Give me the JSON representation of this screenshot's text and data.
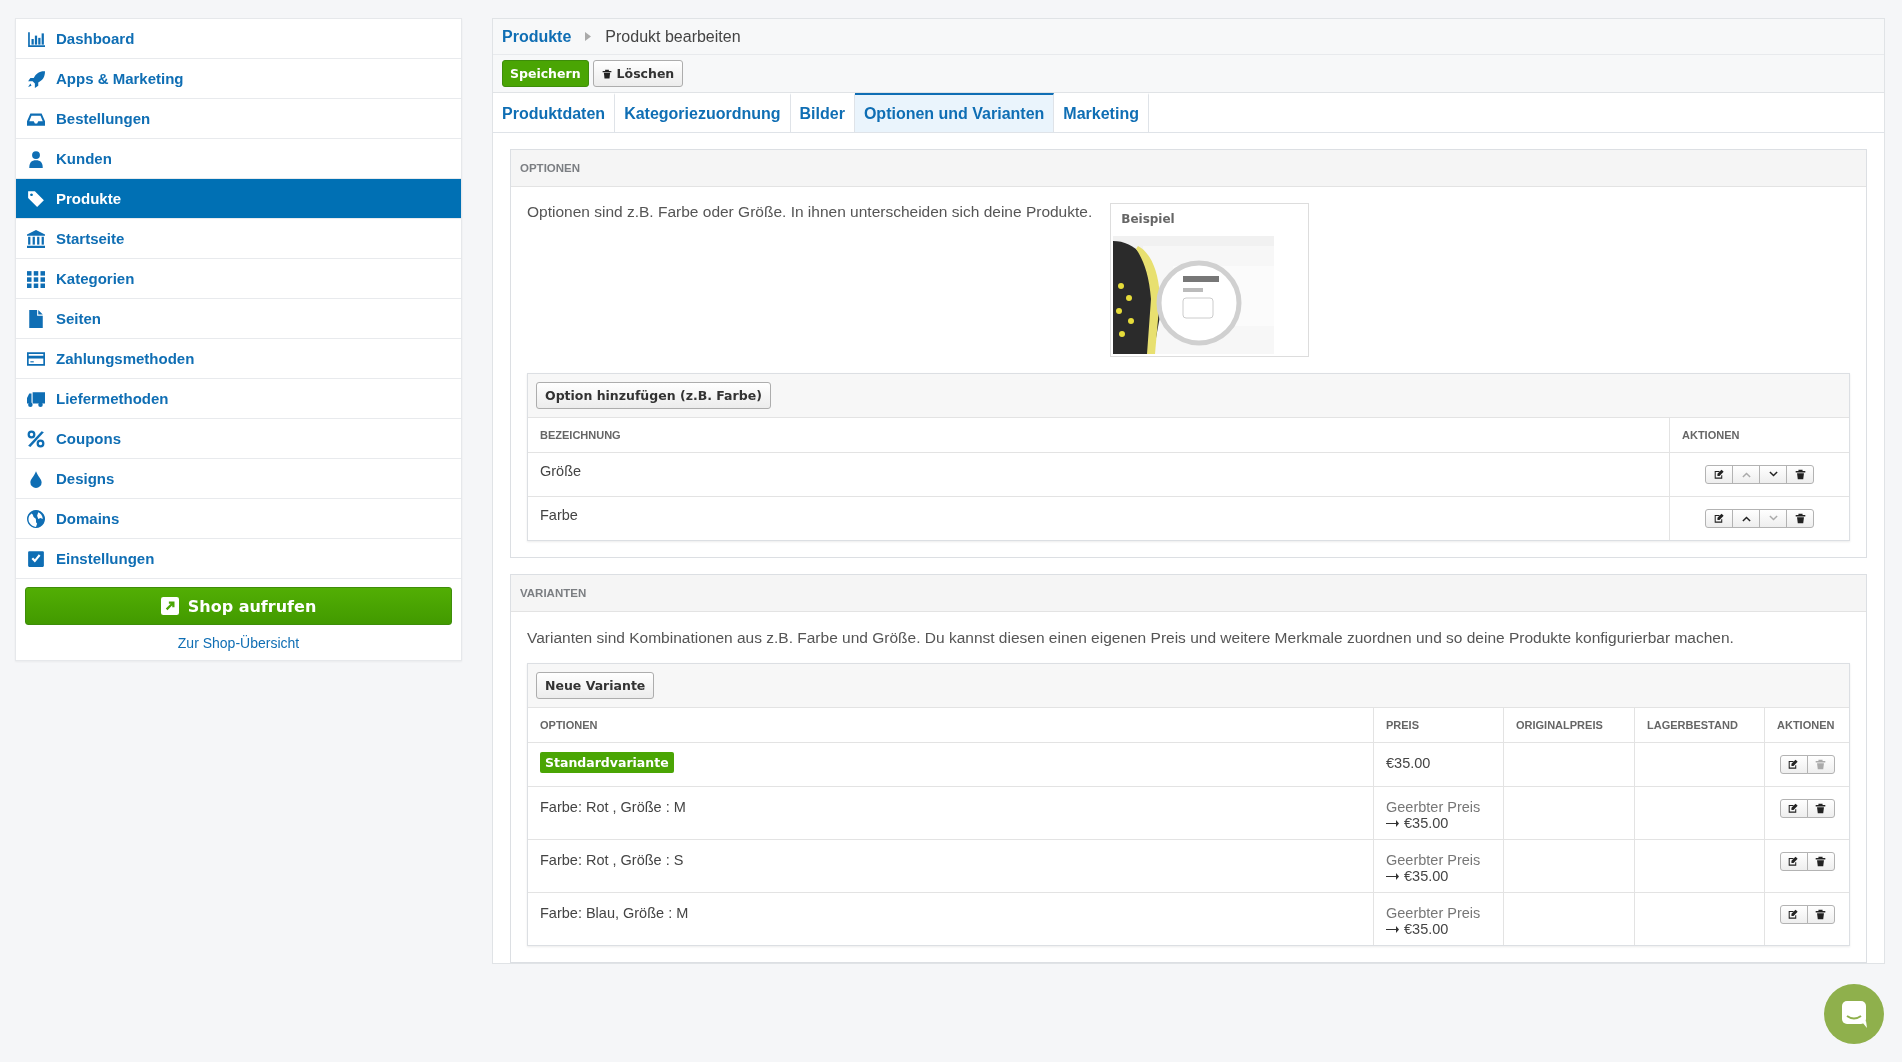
{
  "sidebar": {
    "items": [
      {
        "label": "Dashboard",
        "selected": false
      },
      {
        "label": "Apps & Marketing",
        "selected": false
      },
      {
        "label": "Bestellungen",
        "selected": false
      },
      {
        "label": "Kunden",
        "selected": false
      },
      {
        "label": "Produkte",
        "selected": true
      },
      {
        "label": "Startseite",
        "selected": false
      },
      {
        "label": "Kategorien",
        "selected": false
      },
      {
        "label": "Seiten",
        "selected": false
      },
      {
        "label": "Zahlungsmethoden",
        "selected": false
      },
      {
        "label": "Liefermethoden",
        "selected": false
      },
      {
        "label": "Coupons",
        "selected": false
      },
      {
        "label": "Designs",
        "selected": false
      },
      {
        "label": "Domains",
        "selected": false
      },
      {
        "label": "Einstellungen",
        "selected": false
      }
    ],
    "shop_button": "Shop aufrufen",
    "overview_link": "Zur Shop-Übersicht"
  },
  "breadcrumb": {
    "parent": "Produkte",
    "current": "Produkt bearbeiten"
  },
  "toolbar": {
    "save": "Speichern",
    "delete": "Löschen"
  },
  "tabs": [
    {
      "label": "Produktdaten",
      "selected": false
    },
    {
      "label": "Kategoriezuordnung",
      "selected": false
    },
    {
      "label": "Bilder",
      "selected": false
    },
    {
      "label": "Optionen und Varianten",
      "selected": true
    },
    {
      "label": "Marketing",
      "selected": false
    }
  ],
  "options": {
    "title": "OPTIONEN",
    "description": "Optionen sind z.B. Farbe oder Größe. In ihnen unterscheiden sich deine Produkte.",
    "example": {
      "title": "Beispiel",
      "kind": "picture"
    },
    "add_button": "Option hinzufügen (z.B. Farbe)",
    "columns": [
      "BEZEICHNUNG",
      "AKTIONEN"
    ],
    "rows": [
      {
        "name": "Größe",
        "actions": [
          {
            "kind": "edit",
            "disabled": false
          },
          {
            "kind": "up",
            "disabled": true
          },
          {
            "kind": "down",
            "disabled": false
          },
          {
            "kind": "delete",
            "disabled": false
          }
        ]
      },
      {
        "name": "Farbe",
        "actions": [
          {
            "kind": "edit",
            "disabled": false
          },
          {
            "kind": "up",
            "disabled": false
          },
          {
            "kind": "down",
            "disabled": true
          },
          {
            "kind": "delete",
            "disabled": false
          }
        ]
      }
    ]
  },
  "variants": {
    "title": "VARIANTEN",
    "description": "Varianten sind Kombinationen aus z.B. Farbe und Größe. Du kannst diesen einen eigenen Preis und weitere Merkmale zuordnen und so deine Produkte konfigurierbar machen.",
    "new_button": "Neue Variante",
    "columns": [
      "OPTIONEN",
      "PREIS",
      "ORIGINALPREIS",
      "LAGERBESTAND",
      "AKTIONEN"
    ],
    "rows": [
      {
        "kind": "default",
        "options": "Standardvariante",
        "price": "€35.00",
        "actions": [
          {
            "kind": "edit",
            "disabled": false
          },
          {
            "kind": "delete",
            "disabled": true
          }
        ]
      },
      {
        "kind": "inherited",
        "options": "Farbe: Rot , Größe : M",
        "price_note": "Geerbter Preis",
        "price": "€35.00",
        "actions": [
          {
            "kind": "edit",
            "disabled": false
          },
          {
            "kind": "delete",
            "disabled": false
          }
        ]
      },
      {
        "kind": "inherited",
        "options": "Farbe: Rot , Größe : S",
        "price_note": "Geerbter Preis",
        "price": "€35.00",
        "actions": [
          {
            "kind": "edit",
            "disabled": false
          },
          {
            "kind": "delete",
            "disabled": false
          }
        ]
      },
      {
        "kind": "inherited",
        "options": "Farbe: Blau, Größe : M",
        "price_note": "Geerbter Preis",
        "price": "€35.00",
        "actions": [
          {
            "kind": "edit",
            "disabled": false
          },
          {
            "kind": "delete",
            "disabled": false
          }
        ]
      }
    ]
  }
}
